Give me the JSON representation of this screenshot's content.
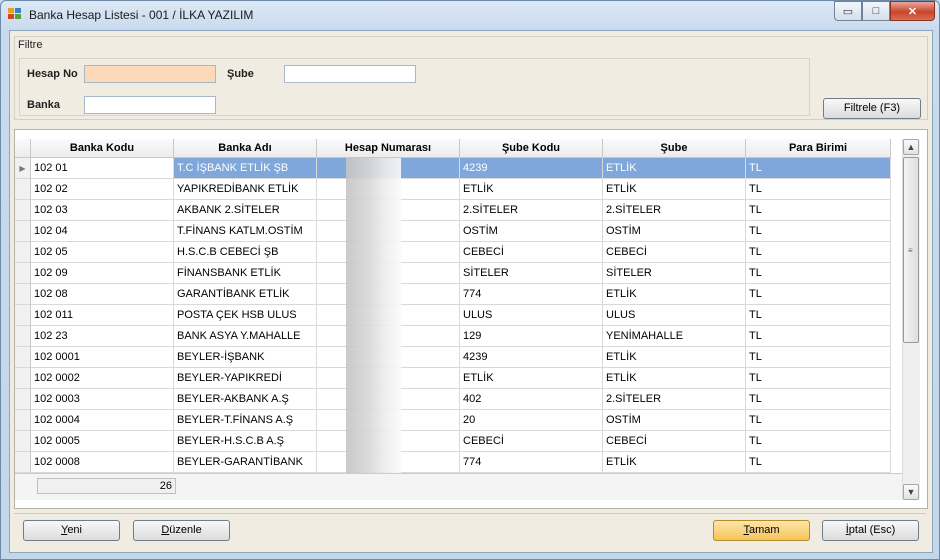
{
  "window": {
    "title": "Banka Hesap Listesi - 001 / İLKA YAZILIM",
    "min_glyph": "▭",
    "max_glyph": "□",
    "close_glyph": "✕",
    "icon": "app-grid-icon"
  },
  "filter": {
    "group_label": "Filtre",
    "hesap_no_label": "Hesap No",
    "hesap_no_value": "",
    "sube_label": "Şube",
    "sube_value": "",
    "banka_label": "Banka",
    "banka_value": "",
    "filter_button": "Filtrele (F3)"
  },
  "grid": {
    "columns": [
      "Banka Kodu",
      "Banka Adı",
      "Hesap Numarası",
      "Şube Kodu",
      "Şube",
      "Para Birimi"
    ],
    "rows": [
      [
        "102 01",
        "T.C İŞBANK ETLİK ŞB",
        "",
        "4239",
        "ETLİK",
        "TL"
      ],
      [
        "102 02",
        "YAPIKREDİBANK ETLİK",
        "",
        "ETLİK",
        "ETLİK",
        "TL"
      ],
      [
        "102 03",
        "AKBANK 2.SİTELER",
        "",
        "2.SİTELER",
        "2.SİTELER",
        "TL"
      ],
      [
        "102 04",
        "T.FİNANS KATLM.OSTİM",
        "",
        "OSTİM",
        "OSTİM",
        "TL"
      ],
      [
        "102 05",
        "H.S.C.B CEBECİ ŞB",
        "",
        "CEBECİ",
        "CEBECİ",
        "TL"
      ],
      [
        "102 09",
        "FİNANSBANK ETLİK",
        "",
        "SİTELER",
        "SİTELER",
        "TL"
      ],
      [
        "102 08",
        "GARANTİBANK ETLİK",
        "",
        "774",
        "ETLİK",
        "TL"
      ],
      [
        "102 011",
        "POSTA ÇEK HSB ULUS",
        "",
        "ULUS",
        "ULUS",
        "TL"
      ],
      [
        "102 23",
        "BANK ASYA Y.MAHALLE",
        "",
        "129",
        "YENİMAHALLE",
        "TL"
      ],
      [
        "102 0001",
        "BEYLER-İŞBANK",
        "",
        "4239",
        "ETLİK",
        "TL"
      ],
      [
        "102 0002",
        "BEYLER-YAPIKREDİ",
        "",
        "ETLİK",
        "ETLİK",
        "TL"
      ],
      [
        "102 0003",
        "BEYLER-AKBANK A.Ş",
        "",
        "402",
        "2.SİTELER",
        "TL"
      ],
      [
        "102 0004",
        "BEYLER-T.FİNANS A.Ş",
        "",
        "20",
        "OSTİM",
        "TL"
      ],
      [
        "102 0005",
        "BEYLER-H.S.C.B A.Ş",
        "",
        "CEBECİ",
        "CEBECİ",
        "TL"
      ],
      [
        "102 0008",
        "BEYLER-GARANTİBANK",
        "",
        "774",
        "ETLİK",
        "TL"
      ]
    ],
    "selected_row": 0,
    "row_indicator_glyph": "▶",
    "record_count": "26",
    "scroll_up_glyph": "▲",
    "scroll_down_glyph": "▼",
    "scroll_grip_glyph": "≡"
  },
  "buttons": {
    "yeni": {
      "mnemonic": "Y",
      "rest": "eni"
    },
    "duzenle": {
      "mnemonic": "D",
      "rest": "üzenle"
    },
    "tamam": {
      "mnemonic": "T",
      "rest": "amam"
    },
    "iptal": {
      "mnemonic": "İ",
      "rest": "ptal (Esc)"
    }
  }
}
